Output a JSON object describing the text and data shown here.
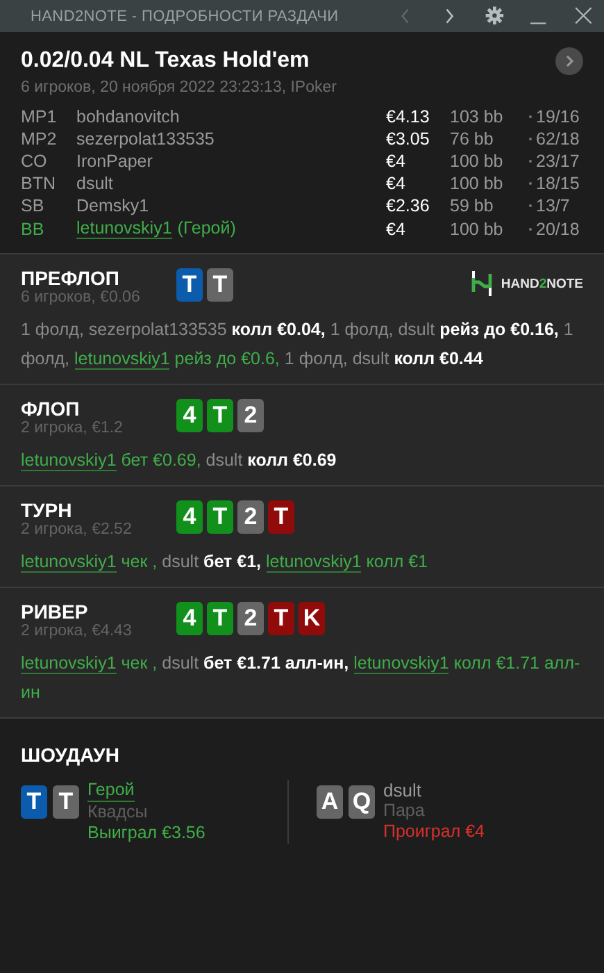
{
  "window": {
    "title": "HAND2NOTE - ПОДРОБНОСТИ РАЗДАЧИ",
    "controls": [
      {
        "kind": "prev",
        "disabled": true
      },
      {
        "kind": "next",
        "disabled": false
      },
      {
        "kind": "settings",
        "disabled": false
      },
      {
        "kind": "minimize",
        "disabled": false
      },
      {
        "kind": "close",
        "disabled": false
      }
    ]
  },
  "hand": {
    "title": "0.02/0.04 NL Texas Hold'em",
    "subtitle": "6 игроков, 20 ноября 2022 23:23:13, IPoker",
    "players": [
      {
        "position": "MP1",
        "name": "bohdanovitch",
        "hero": false,
        "stack": "€4.13",
        "bb": "103 bb",
        "stats": "19/16"
      },
      {
        "position": "MP2",
        "name": "sezerpolat133535",
        "hero": false,
        "stack": "€3.05",
        "bb": "76 bb",
        "stats": "62/18"
      },
      {
        "position": "CO",
        "name": "IronPaper",
        "hero": false,
        "stack": "€4",
        "bb": "100 bb",
        "stats": "23/17"
      },
      {
        "position": "BTN",
        "name": "dsult",
        "hero": false,
        "stack": "€4",
        "bb": "100 bb",
        "stats": "18/15"
      },
      {
        "position": "SB",
        "name": "Demsky1",
        "hero": false,
        "stack": "€2.36",
        "bb": "59 bb",
        "stats": "13/7"
      },
      {
        "position": "BB",
        "name": "letunovskiy1",
        "tag": "(Герой)",
        "hero": true,
        "stack": "€4",
        "bb": "100 bb",
        "stats": "20/18"
      }
    ]
  },
  "streets": [
    {
      "name": "ПРЕФЛОП",
      "info": "6 игроков, €0.06",
      "cards": [
        {
          "rank": "T",
          "color": "#0b5cad"
        },
        {
          "rank": "T",
          "color": "#666666"
        }
      ],
      "logo": {
        "before": "HAND",
        "accent": "2",
        "after": "NOTE"
      },
      "actions": [
        {
          "kind": "muted",
          "text": "1 фолд, sezerpolat133535"
        },
        {
          "kind": "strong",
          "text": "колл €0.04,"
        },
        {
          "kind": "muted",
          "text": "1 фолд, dsult"
        },
        {
          "kind": "strong",
          "text": "рейз до €0.16,"
        },
        {
          "kind": "muted",
          "text": "1 фолд,"
        },
        {
          "kind": "hero",
          "text": "letunovskiy1"
        },
        {
          "kind": "hero-act",
          "text": "рейз до €0.6,"
        },
        {
          "kind": "muted",
          "text": "1 фолд, dsult"
        },
        {
          "kind": "strong",
          "text": "колл €0.44"
        }
      ]
    },
    {
      "name": "ФЛОП",
      "info": "2 игрока, €1.2",
      "cards": [
        {
          "rank": "4",
          "color": "#12901c"
        },
        {
          "rank": "T",
          "color": "#12901c"
        },
        {
          "rank": "2",
          "color": "#666666"
        }
      ],
      "actions": [
        {
          "kind": "hero",
          "text": "letunovskiy1"
        },
        {
          "kind": "hero-act",
          "text": "бет €0.69,"
        },
        {
          "kind": "muted",
          "text": "dsult"
        },
        {
          "kind": "strong",
          "text": "колл €0.69"
        }
      ]
    },
    {
      "name": "ТУРН",
      "info": "2 игрока, €2.52",
      "cards": [
        {
          "rank": "4",
          "color": "#12901c"
        },
        {
          "rank": "T",
          "color": "#12901c"
        },
        {
          "rank": "2",
          "color": "#666666"
        },
        {
          "rank": "T",
          "color": "#920b0b"
        }
      ],
      "actions": [
        {
          "kind": "hero",
          "text": "letunovskiy1"
        },
        {
          "kind": "hero-act",
          "text": "чек ,"
        },
        {
          "kind": "muted",
          "text": "dsult"
        },
        {
          "kind": "strong",
          "text": "бет €1,"
        },
        {
          "kind": "hero",
          "text": "letunovskiy1"
        },
        {
          "kind": "hero-act",
          "text": "колл €1"
        }
      ]
    },
    {
      "name": "РИВЕР",
      "info": "2 игрока, €4.43",
      "cards": [
        {
          "rank": "4",
          "color": "#12901c"
        },
        {
          "rank": "T",
          "color": "#12901c"
        },
        {
          "rank": "2",
          "color": "#666666"
        },
        {
          "rank": "T",
          "color": "#920b0b"
        },
        {
          "rank": "K",
          "color": "#920b0b"
        }
      ],
      "actions": [
        {
          "kind": "hero",
          "text": "letunovskiy1"
        },
        {
          "kind": "hero-act",
          "text": "чек ,"
        },
        {
          "kind": "muted",
          "text": "dsult"
        },
        {
          "kind": "strong",
          "text": "бет €1.71 алл-ин,"
        },
        {
          "kind": "hero",
          "text": "letunovskiy1"
        },
        {
          "kind": "hero-act",
          "text": "колл €1.71 алл-ин"
        }
      ]
    }
  ],
  "showdown": {
    "title": "ШОУДАУН",
    "players": [
      {
        "name": "Герой",
        "hero": true,
        "hand": "Квадсы",
        "result": "Выиграл €3.56",
        "won": true,
        "cards": [
          {
            "rank": "T",
            "color": "#0b5cad"
          },
          {
            "rank": "T",
            "color": "#666666"
          }
        ]
      },
      {
        "name": "dsult",
        "hero": false,
        "hand": "Пара",
        "result": "Проиграл €4",
        "won": false,
        "cards": [
          {
            "rank": "A",
            "color": "#666666"
          },
          {
            "rank": "Q",
            "color": "#666666"
          }
        ]
      }
    ]
  }
}
